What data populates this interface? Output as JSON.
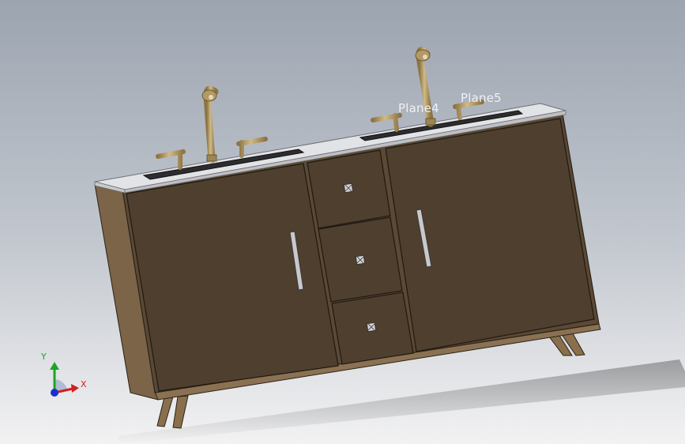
{
  "viewport": {
    "planes": [
      {
        "id": "plane4",
        "label": "Plane4"
      },
      {
        "id": "plane5",
        "label": "Plane5"
      }
    ],
    "triad": {
      "x_label": "X",
      "y_label": "Y"
    }
  },
  "model": {
    "parts": [
      "countertop",
      "cabinet-body",
      "left-door",
      "right-door",
      "drawer-top",
      "drawer-middle",
      "drawer-bottom",
      "left-faucet",
      "right-faucet",
      "left-sink",
      "right-sink",
      "legs"
    ]
  },
  "colors": {
    "background_top": "#9ca4b0",
    "background_bottom": "#f2f2f3",
    "cabinet_front": "#4f3f2e",
    "cabinet_side": "#7c6448",
    "countertop": "#e2e3e6",
    "brass": "#b39a63",
    "sink": "#2d2d2f",
    "axis_x": "#d21f1f",
    "axis_y": "#1aa521",
    "axis_z": "#1a2fd0"
  }
}
